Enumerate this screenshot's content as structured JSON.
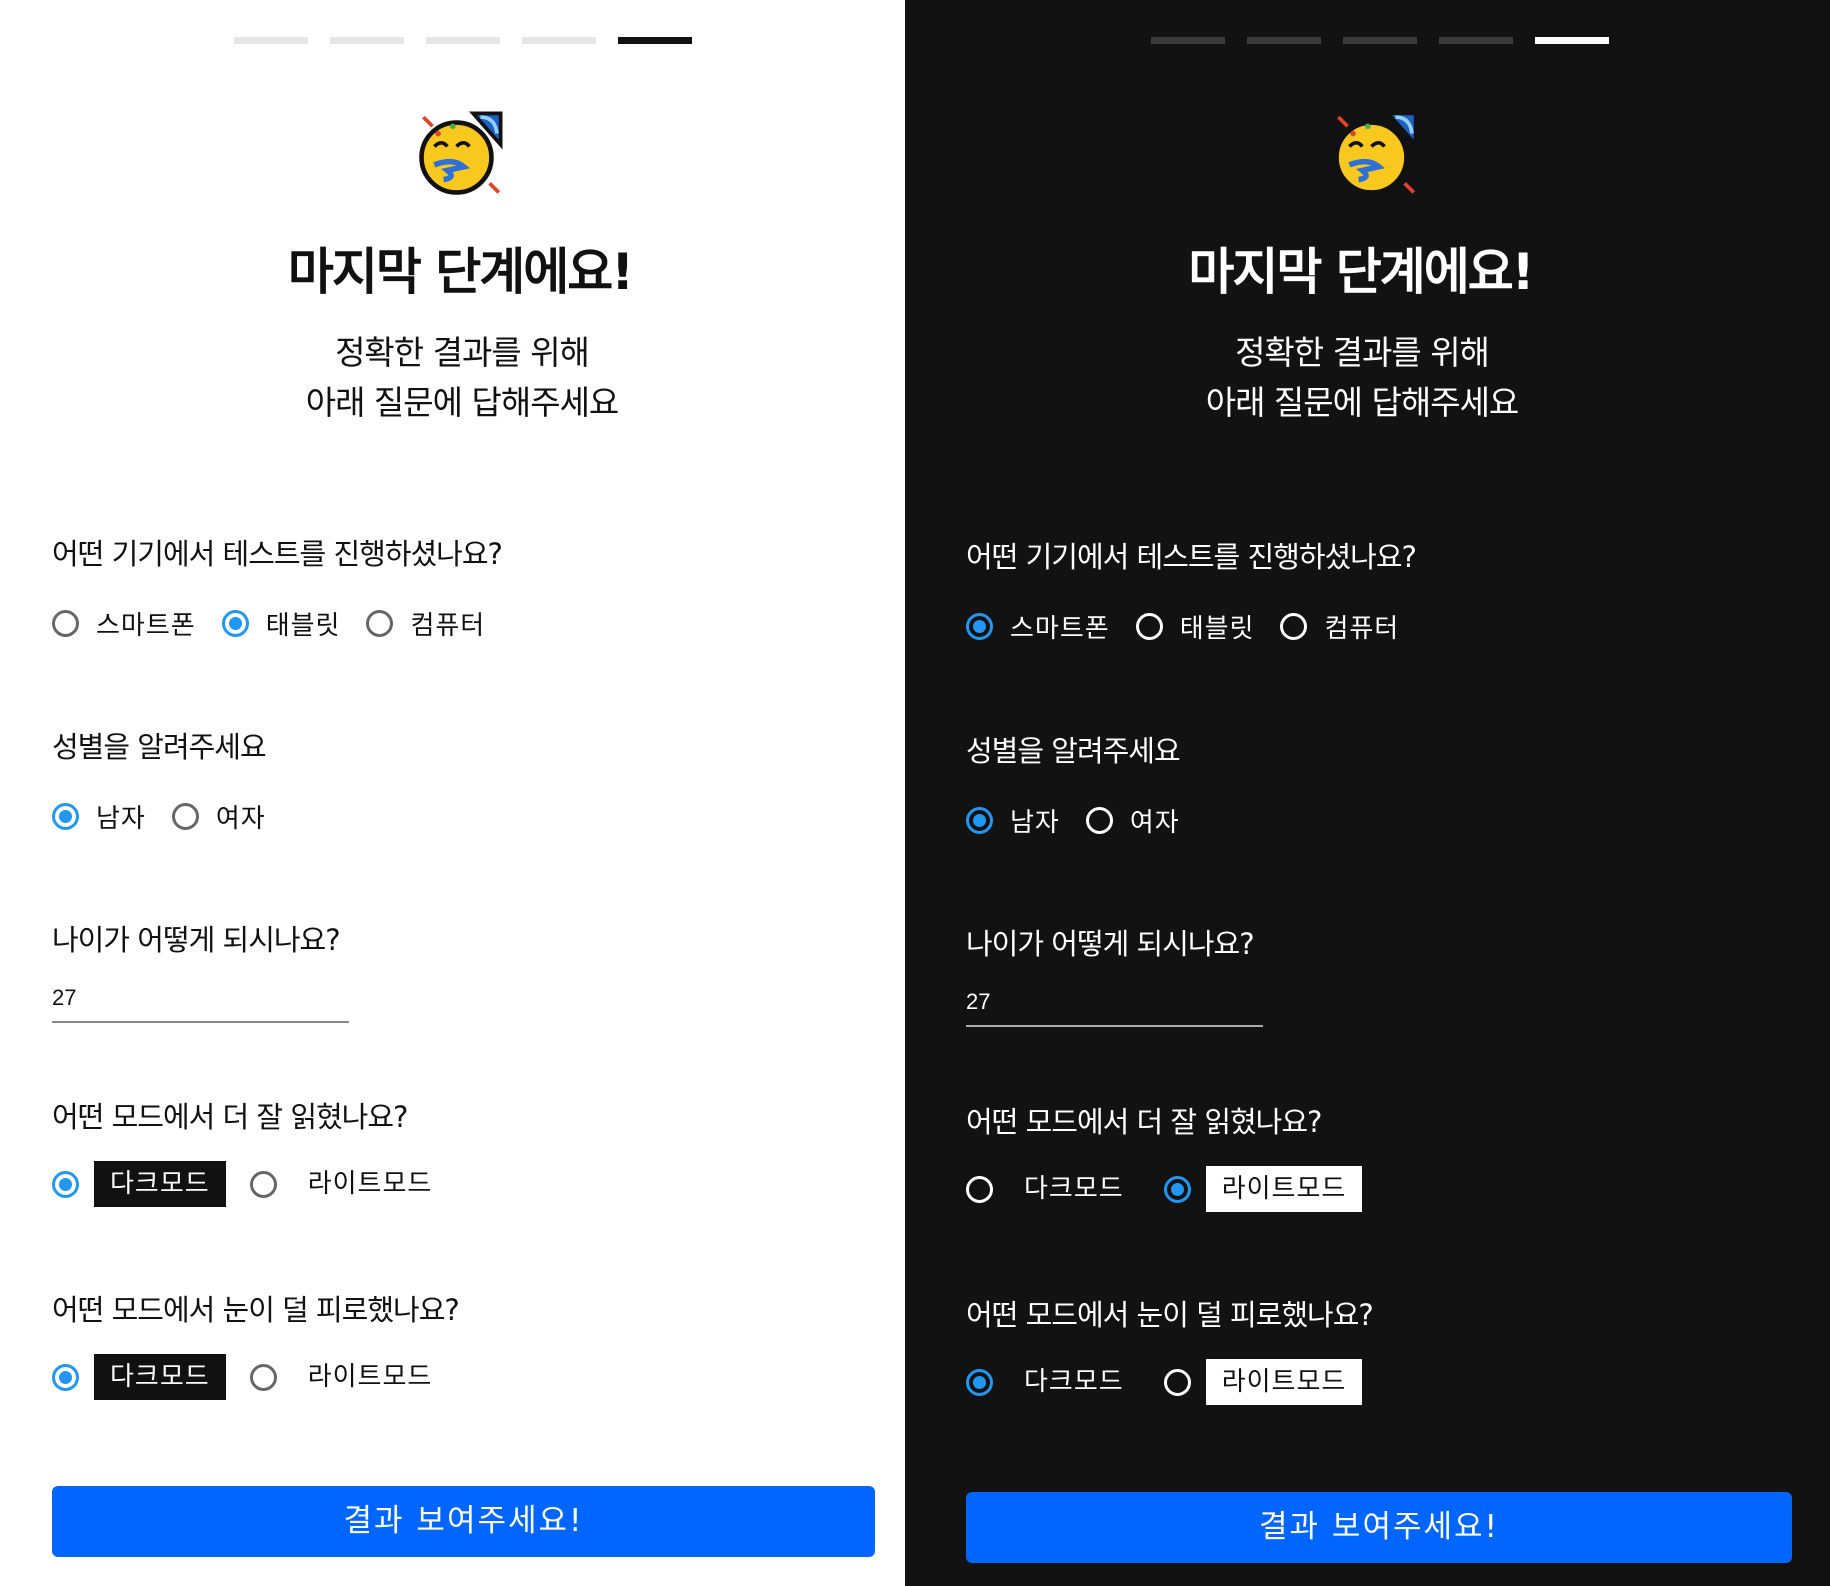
{
  "title": "마지막 단계에요!",
  "subtitle_line1": "정확한 결과를 위해",
  "subtitle_line2": "아래 질문에 답해주세요",
  "q_device": "어떤 기기에서 테스트를 진행하셨나요?",
  "device_options": [
    "스마트폰",
    "태블릿",
    "컴퓨터"
  ],
  "q_gender": "성별을 알려주세요",
  "gender_options": [
    "남자",
    "여자"
  ],
  "q_age": "나이가 어떻게 되시나요?",
  "age_value": "27",
  "q_readability": "어떤 모드에서 더 잘 읽혔나요?",
  "q_eyestrain": "어떤 모드에서 눈이 덜 피로했나요?",
  "mode_options": [
    "다크모드",
    "라이트모드"
  ],
  "submit_label": "결과 보여주세요!",
  "progress_total": 5,
  "progress_current": 5,
  "accent_color": "#2196f3",
  "button_color": "#0066ff",
  "light": {
    "device_selected": "태블릿",
    "gender_selected": "남자",
    "readability_selected": "다크모드",
    "eyestrain_selected": "다크모드"
  },
  "dark": {
    "device_selected": "스마트폰",
    "gender_selected": "남자",
    "readability_selected": "라이트모드",
    "eyestrain_selected": "다크모드"
  }
}
